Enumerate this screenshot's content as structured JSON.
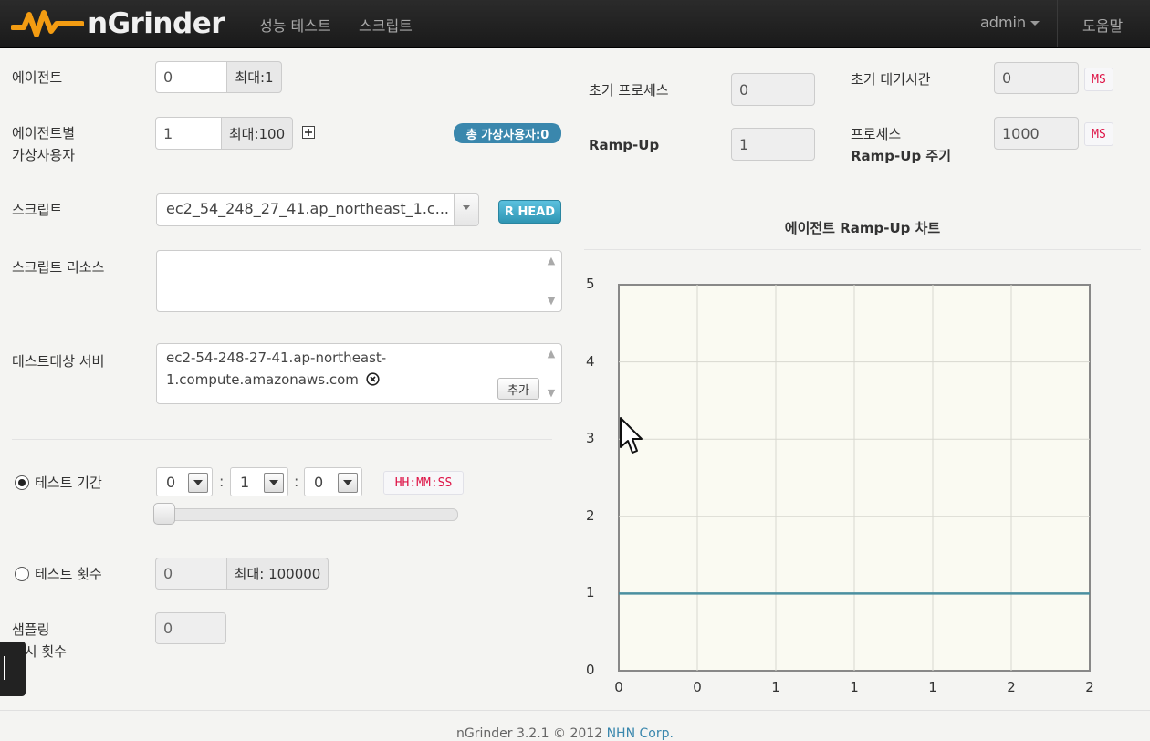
{
  "nav": {
    "brand": "nGrinder",
    "links": [
      "성능 테스트",
      "스크립트"
    ],
    "user": "admin",
    "help": "도움말"
  },
  "form": {
    "agent": {
      "label": "에이전트",
      "value": "0",
      "max": "최대:1"
    },
    "vuser": {
      "label_line1": "에이전트별",
      "label_line2": "가상사용자",
      "value": "1",
      "max": "최대:100"
    },
    "total_vusers_badge": "총 가상사용자:0",
    "script": {
      "label": "스크립트",
      "selected": "ec2_54_248_27_41.ap_northeast_1.c...",
      "head_button": "R HEAD"
    },
    "script_resource": {
      "label": "스크립트 리소스"
    },
    "target_server": {
      "label": "테스트대상 서버",
      "line1": "ec2-54-248-27-41.ap-northeast-",
      "line2": "1.compute.amazonaws.com",
      "add_button": "추가"
    },
    "duration": {
      "label": "테스트 기간",
      "selected": true,
      "hours": "0",
      "minutes": "1",
      "seconds": "0",
      "separator": ":",
      "format": "HH:MM:SS",
      "slider_level": 0
    },
    "run_count": {
      "label": "테스트 횟수",
      "selected": false,
      "value": "0",
      "max": "최대: 100000"
    },
    "ignore_sample": {
      "label_line1": "샘플링",
      "label_line2": "무시 횟수",
      "value": "0"
    }
  },
  "rampup": {
    "init_process": {
      "label": "초기 프로세스",
      "value": "0"
    },
    "init_sleep": {
      "label": "초기 대기시간",
      "value": "0",
      "unit": "MS"
    },
    "rampup": {
      "label": "Ramp-Up",
      "value": "1"
    },
    "interval": {
      "label_line1": "프로세스",
      "label_line2": "Ramp-Up 주기",
      "value": "1000",
      "unit": "MS"
    }
  },
  "chart_data": {
    "type": "line",
    "title": "에이전트 Ramp-Up 차트",
    "x_tick_labels": [
      "0",
      "0",
      "1",
      "1",
      "1",
      "2",
      "2"
    ],
    "y_tick_labels": [
      "0",
      "1",
      "2",
      "3",
      "4",
      "5"
    ],
    "ylim": [
      0,
      5
    ],
    "grid": true,
    "series": [
      {
        "values": [
          1,
          1,
          1,
          1,
          1,
          1,
          1
        ]
      }
    ],
    "line_color": "#4a8fa0"
  },
  "footer": {
    "text": "nGrinder 3.2.1 © 2012 ",
    "link": "NHN Corp."
  }
}
